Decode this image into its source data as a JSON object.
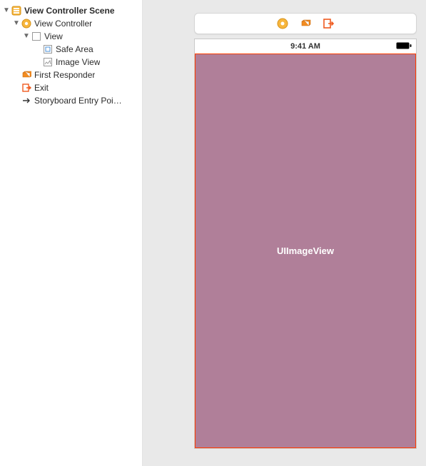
{
  "tree": {
    "scene_label": "View Controller Scene",
    "vc_label": "View Controller",
    "view_label": "View",
    "safe_area_label": "Safe Area",
    "image_view_label": "Image View",
    "first_responder_label": "First Responder",
    "exit_label": "Exit",
    "entry_point_label": "Storyboard Entry Poi…"
  },
  "canvas": {
    "status_time": "9:41 AM",
    "placeholder_label": "UIImageView"
  },
  "colors": {
    "orange": "#f28c22",
    "exit_orange": "#ef5a1f",
    "imageview_fill": "#b07f99",
    "selection_outline": "#ff3b00"
  }
}
